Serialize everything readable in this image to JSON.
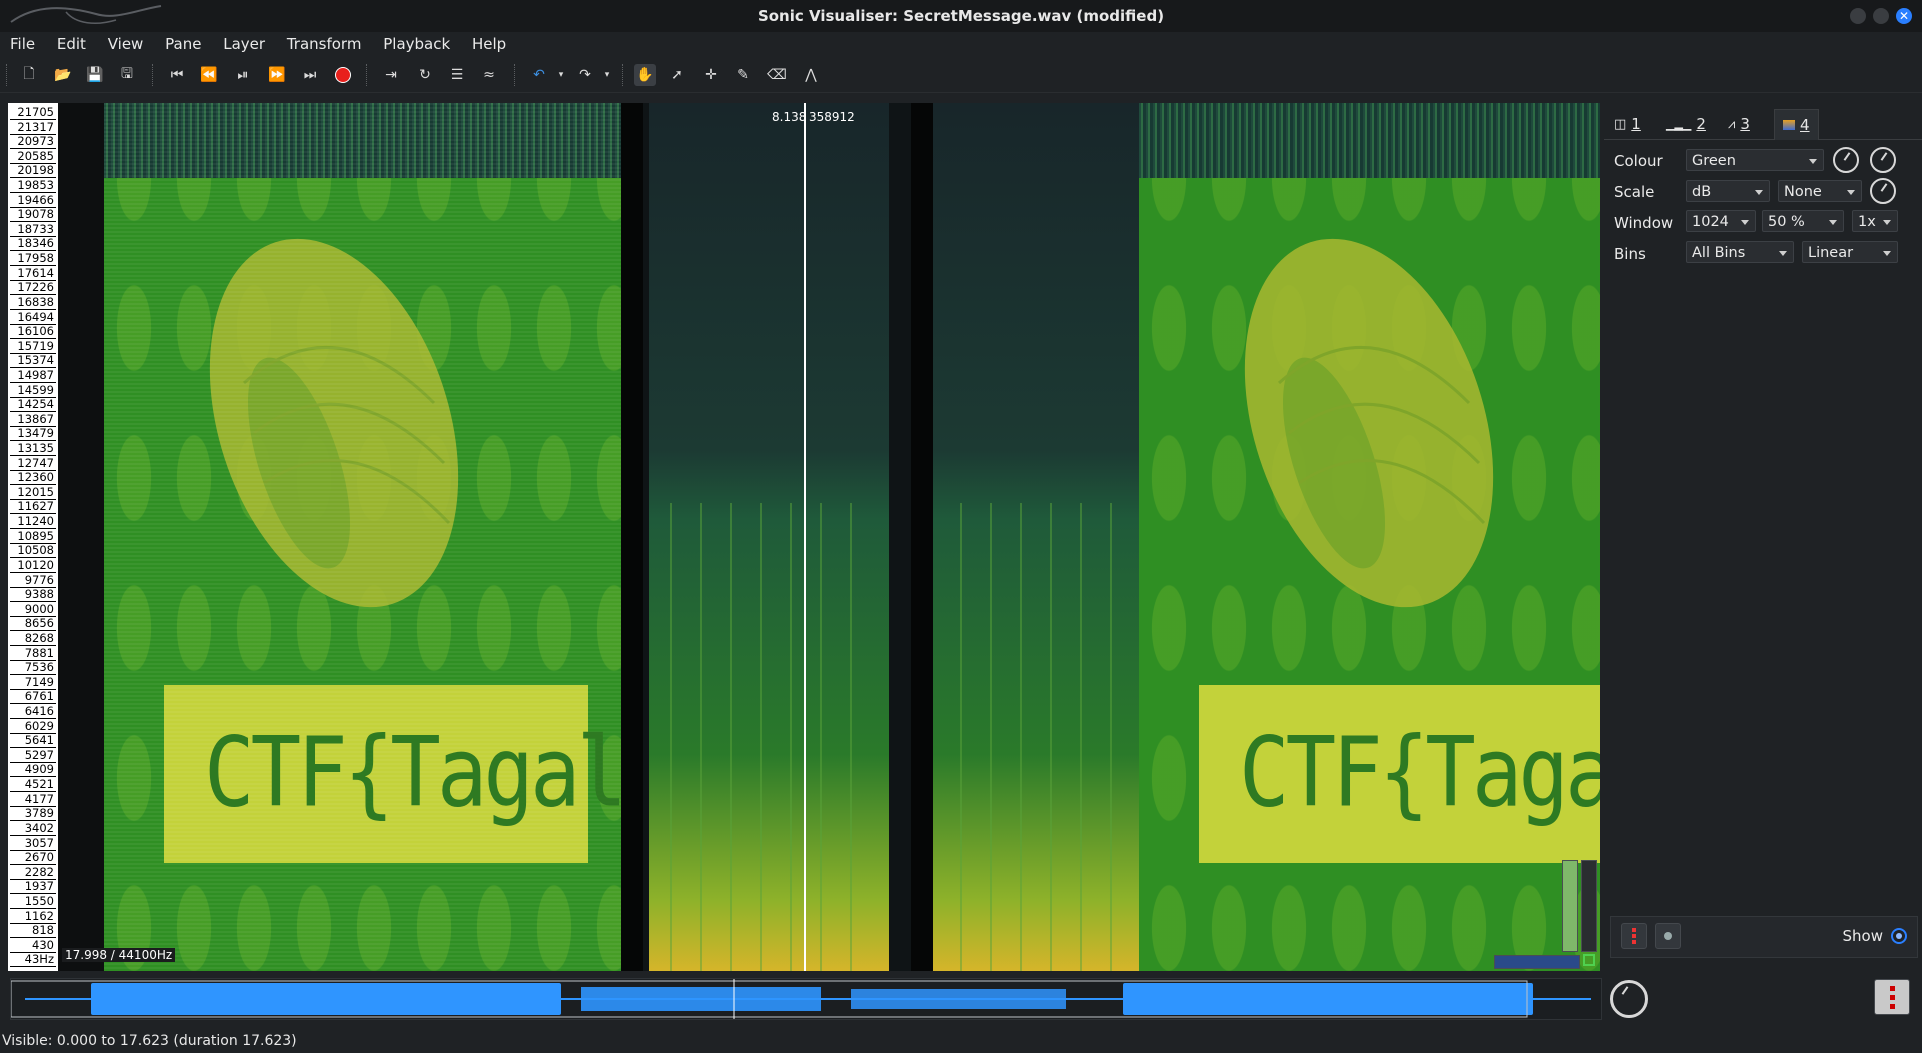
{
  "window": {
    "title": "Sonic Visualiser: SecretMessage.wav (modified)"
  },
  "menu": [
    "File",
    "Edit",
    "View",
    "Pane",
    "Layer",
    "Transform",
    "Playback",
    "Help"
  ],
  "toolbar": {
    "icons": [
      "new-file-icon",
      "open-icon",
      "save-icon",
      "save-session-icon",
      "rewind-start-icon",
      "rewind-icon",
      "play-pause-icon",
      "fast-forward-icon",
      "ffwd-end-icon",
      "record-icon",
      "play-selection-icon",
      "loop-icon",
      "solo-icon",
      "follow-playback-icon",
      "undo-icon",
      "redo-icon",
      "navigate-icon",
      "select-icon",
      "move-icon",
      "draw-icon",
      "erase-icon",
      "measure-icon"
    ]
  },
  "spectrogram": {
    "frequency_ticks": [
      "21705",
      "21317",
      "20973",
      "20585",
      "20198",
      "19853",
      "19466",
      "19078",
      "18733",
      "18346",
      "17958",
      "17614",
      "17226",
      "16838",
      "16494",
      "16106",
      "15719",
      "15374",
      "14987",
      "14599",
      "14254",
      "13867",
      "13479",
      "13135",
      "12747",
      "12360",
      "12015",
      "11627",
      "11240",
      "10895",
      "10508",
      "10120",
      "9776",
      "9388",
      "9000",
      "8656",
      "8268",
      "7881",
      "7536",
      "7149",
      "6761",
      "6416",
      "6029",
      "5641",
      "5297",
      "4909",
      "4521",
      "4177",
      "3789",
      "3402",
      "3057",
      "2670",
      "2282",
      "1937",
      "1550",
      "1162",
      "818",
      "430",
      "43Hz"
    ],
    "cursor_time": "8.138",
    "cursor_sample": "358912",
    "footer_label": "17.998 / 44100Hz",
    "flag_text": "CTF{Tagalog}"
  },
  "side_panel": {
    "tabs": [
      {
        "label": "1",
        "icon": "pane-icon"
      },
      {
        "label": "2",
        "icon": "ruler-icon"
      },
      {
        "label": "3",
        "icon": "waveform-icon"
      },
      {
        "label": "4",
        "icon": "spectrogram-icon"
      }
    ],
    "colour_label": "Colour",
    "colour_value": "Green",
    "scale_label": "Scale",
    "scale_value": "dB",
    "normalize_value": "None",
    "window_label": "Window",
    "window_size": "1024",
    "window_overlap": "50 %",
    "window_oversample": "1x",
    "bins_label": "Bins",
    "bins_value": "All Bins",
    "bins_scale": "Linear",
    "show_label": "Show"
  },
  "status": {
    "visible_text": "Visible: 0.000 to 17.623 (duration 17.623)"
  },
  "colors": {
    "accent": "#2a7fff",
    "waveform": "#2f95ff",
    "spectrogram_green": "#2f8f23",
    "flag_box": "#c3d23a"
  }
}
